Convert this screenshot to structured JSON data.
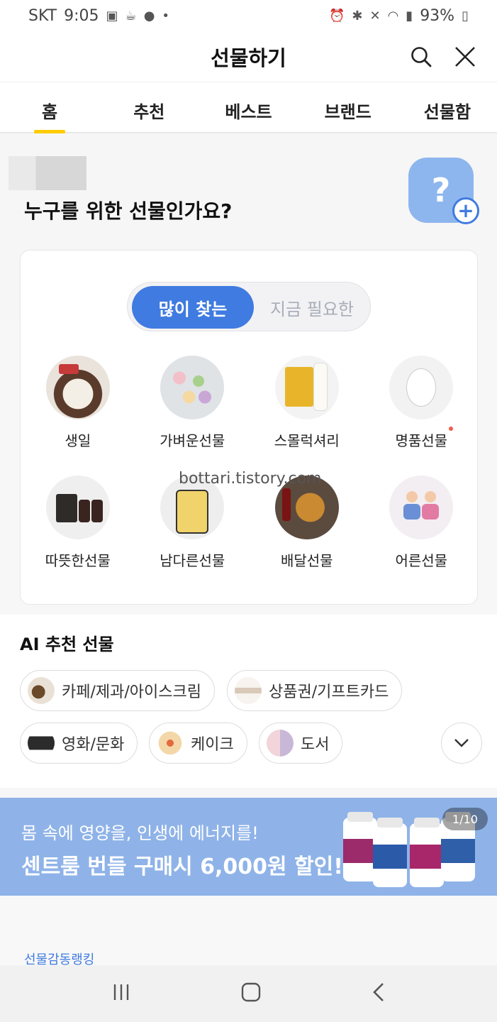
{
  "status_bar": {
    "carrier": "SKT",
    "time": "9:05",
    "battery": "93%"
  },
  "header": {
    "title": "선물하기"
  },
  "tabs": [
    {
      "label": "홈",
      "active": true
    },
    {
      "label": "추천",
      "active": false
    },
    {
      "label": "베스트",
      "active": false
    },
    {
      "label": "브랜드",
      "active": false
    },
    {
      "label": "선물함",
      "active": false
    }
  ],
  "hero": {
    "question": "누구를 위한 선물인가요?",
    "help_icon": "?"
  },
  "toggle": {
    "on_label": "많이 찾는",
    "off_label": "지금 필요한"
  },
  "categories": [
    {
      "label": "생일",
      "icon": "birthday-cake-icon"
    },
    {
      "label": "가벼운선물",
      "icon": "macaron-icon"
    },
    {
      "label": "스몰럭셔리",
      "icon": "cosmetics-icon"
    },
    {
      "label": "명품선물",
      "icon": "perfume-icon",
      "has_new_dot": true
    },
    {
      "label": "따뜻한선물",
      "icon": "gift-set-icon"
    },
    {
      "label": "남다른선물",
      "icon": "snack-icon"
    },
    {
      "label": "배달선물",
      "icon": "chicken-icon"
    },
    {
      "label": "어른선물",
      "icon": "custom-cake-icon"
    }
  ],
  "watermark": "bottari.tistory.com",
  "ai_section": {
    "title": "AI 추천 선물",
    "chips": [
      {
        "label": "카페/제과/아이스크림"
      },
      {
        "label": "상품권/기프트카드"
      },
      {
        "label": "영화/문화"
      },
      {
        "label": "케이크"
      },
      {
        "label": "도서"
      }
    ]
  },
  "banner": {
    "line1": "몸 속에 영양을, 인생에 에너지를!",
    "line2": "센트룸 번들 구매시 6,000원 할인!",
    "counter": "1/10"
  },
  "ranking": {
    "title": "선물감동랭킹"
  },
  "colors": {
    "accent_yellow": "#ffcc00",
    "primary_blue": "#3f7be0",
    "banner_blue": "#8fb3e8"
  }
}
